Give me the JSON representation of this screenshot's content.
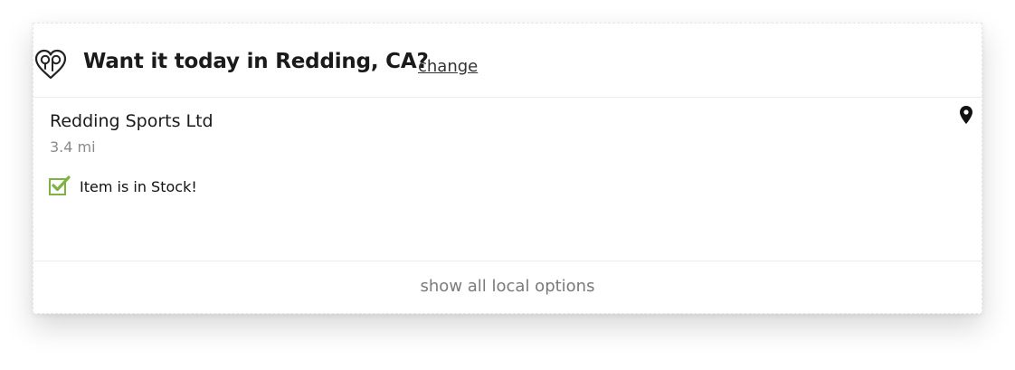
{
  "header": {
    "icon": "local-pickup-logo-icon",
    "title": "Want it today in Redding, CA?",
    "change_label": "change"
  },
  "store": {
    "name": "Redding Sports Ltd",
    "distance": "3.4 mi",
    "location_icon": "map-pin-icon",
    "stock_icon": "checkbox-checked-icon",
    "stock_status": "Item is in Stock!",
    "stock_color": "#7cb342"
  },
  "footer": {
    "label": "show all local options"
  }
}
